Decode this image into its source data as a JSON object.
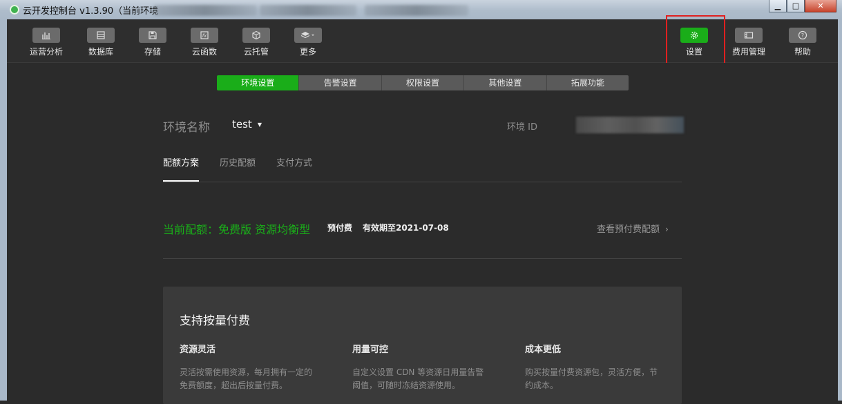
{
  "window": {
    "title": "云开发控制台 v1.3.90（当前环境",
    "minimize": "▁",
    "maximize": "□",
    "close": "✕"
  },
  "toolbar": {
    "items": [
      {
        "label": "运营分析",
        "icon": "bar-chart-icon"
      },
      {
        "label": "数据库",
        "icon": "database-icon"
      },
      {
        "label": "存储",
        "icon": "save-icon"
      },
      {
        "label": "云函数",
        "icon": "function-icon"
      },
      {
        "label": "云托管",
        "icon": "cube-icon"
      },
      {
        "label": "更多",
        "icon": "layers-dropdown-icon"
      }
    ],
    "right_items": [
      {
        "label": "设置",
        "icon": "gear-icon",
        "active": true
      },
      {
        "label": "费用管理",
        "icon": "billing-icon"
      },
      {
        "label": "帮助",
        "icon": "help-icon"
      }
    ]
  },
  "settings_tabs": [
    "环境设置",
    "告警设置",
    "权限设置",
    "其他设置",
    "拓展功能"
  ],
  "environment": {
    "name_label": "环境名称",
    "name_value": "test",
    "id_label": "环境 ID"
  },
  "sub_tabs": [
    "配额方案",
    "历史配额",
    "支付方式"
  ],
  "quota": {
    "title": "当前配额：免费版 资源均衡型",
    "pay_type": "预付费",
    "valid_until": "有效期至2021-07-08",
    "view_link": "查看预付费配额"
  },
  "promo": {
    "title": "支持按量付费",
    "features": [
      {
        "title": "资源灵活",
        "desc": "灵活按需使用资源，每月拥有一定的免费额度，超出后按量付费。"
      },
      {
        "title": "用量可控",
        "desc": "自定义设置 CDN 等资源日用量告警阈值，可随时冻结资源使用。"
      },
      {
        "title": "成本更低",
        "desc": "购买按量付费资源包，灵活方便，节约成本。"
      }
    ]
  },
  "colors": {
    "accent": "#1aad19",
    "highlight": "#e02020",
    "background": "#2b2b2b"
  }
}
